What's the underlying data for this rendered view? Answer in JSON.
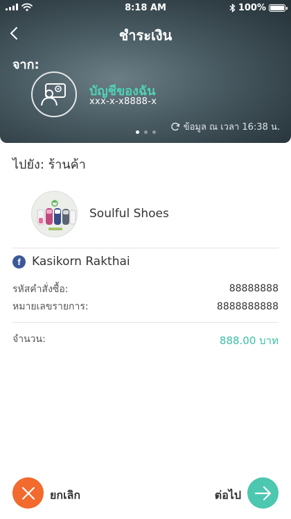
{
  "status_bar": {
    "time": "8:18 AM",
    "battery": "100%",
    "battery_level": 1.0
  },
  "header": {
    "title": "ชำระเงิน",
    "back_icon": "chevron-left-icon"
  },
  "from": {
    "label": "จาก:",
    "account_name": "บัญชีของฉัน",
    "account_number": "xxx-x-x8888-x",
    "data_time": "ข้อมูล ณ เวลา 16:38 น.",
    "page_dots": {
      "count": 3,
      "active": 0
    }
  },
  "to": {
    "label": "ไปยัง: ร้านค้า",
    "merchant_name": "Soulful Shoes",
    "facebook_name": "Kasikorn Rakthai"
  },
  "details": {
    "order_label": "รหัสคำสั่งซื้อ:",
    "order_value": "88888888",
    "ref_label": "หมายเลขรายการ:",
    "ref_value": "8888888888",
    "amount_label": "จำนวน:",
    "amount_value": "888.00 บาท"
  },
  "actions": {
    "cancel_label": "ยกเลิก",
    "next_label": "ต่อไป"
  },
  "colors": {
    "accent": "#4cc7b0",
    "cancel": "#f26a2e",
    "facebook": "#3b5998"
  }
}
